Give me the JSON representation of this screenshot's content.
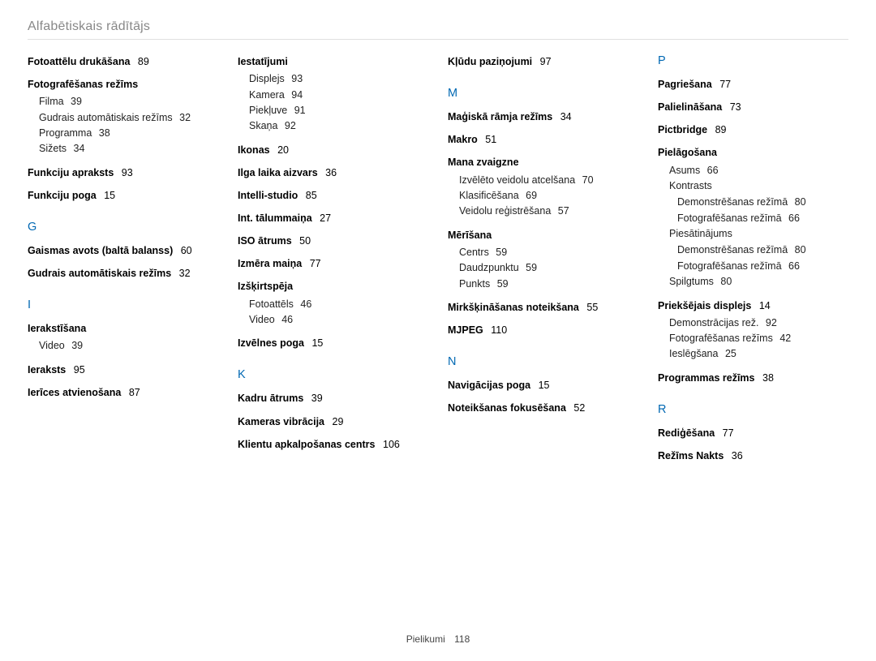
{
  "header": "Alfabētiskais rādītājs",
  "footer": {
    "section": "Pielikumi",
    "page": "118"
  },
  "columns": [
    {
      "items": [
        {
          "type": "entry",
          "title": "Fotoattēlu drukāšana",
          "page": "89"
        },
        {
          "type": "entry",
          "title": "Fotografēšanas režīms",
          "subs": [
            {
              "label": "Filma",
              "page": "39"
            },
            {
              "label": "Gudrais automātiskais režīms",
              "page": "32"
            },
            {
              "label": "Programma",
              "page": "38"
            },
            {
              "label": "Sižets",
              "page": "34"
            }
          ]
        },
        {
          "type": "entry",
          "title": "Funkciju apraksts",
          "page": "93"
        },
        {
          "type": "entry",
          "title": "Funkciju poga",
          "page": "15"
        },
        {
          "type": "letter",
          "text": "G"
        },
        {
          "type": "entry",
          "title": "Gaismas avots (baltā balanss)",
          "page": "60"
        },
        {
          "type": "entry",
          "title": "Gudrais automātiskais režīms",
          "page": "32"
        },
        {
          "type": "letter",
          "text": "I"
        },
        {
          "type": "entry",
          "title": "Ierakstīšana",
          "subs": [
            {
              "label": "Video",
              "page": "39"
            }
          ]
        },
        {
          "type": "entry",
          "title": "Ieraksts",
          "page": "95"
        },
        {
          "type": "entry",
          "title": "Ierīces atvienošana",
          "page": "87"
        }
      ]
    },
    {
      "items": [
        {
          "type": "entry",
          "title": "Iestatījumi",
          "subs": [
            {
              "label": "Displejs",
              "page": "93"
            },
            {
              "label": "Kamera",
              "page": "94"
            },
            {
              "label": "Piekļuve",
              "page": "91"
            },
            {
              "label": "Skaņa",
              "page": "92"
            }
          ]
        },
        {
          "type": "entry",
          "title": "Ikonas",
          "page": "20"
        },
        {
          "type": "entry",
          "title": "Ilga laika aizvars",
          "page": "36"
        },
        {
          "type": "entry",
          "title": "Intelli-studio",
          "page": "85"
        },
        {
          "type": "entry",
          "title": "Int. tālummaiņa",
          "page": "27"
        },
        {
          "type": "entry",
          "title": "ISO ātrums",
          "page": "50"
        },
        {
          "type": "entry",
          "title": "Izmēra maiņa",
          "page": "77"
        },
        {
          "type": "entry",
          "title": "Izšķirtspēja",
          "subs": [
            {
              "label": "Fotoattēls",
              "page": "46"
            },
            {
              "label": "Video",
              "page": "46"
            }
          ]
        },
        {
          "type": "entry",
          "title": "Izvēlnes poga",
          "page": "15"
        },
        {
          "type": "letter",
          "text": "K"
        },
        {
          "type": "entry",
          "title": "Kadru ātrums",
          "page": "39"
        },
        {
          "type": "entry",
          "title": "Kameras vibrācija",
          "page": "29"
        },
        {
          "type": "entry",
          "title": "Klientu apkalpošanas centrs",
          "page": "106"
        }
      ]
    },
    {
      "items": [
        {
          "type": "entry",
          "title": "Kļūdu paziņojumi",
          "page": "97"
        },
        {
          "type": "letter",
          "text": "M"
        },
        {
          "type": "entry",
          "title": "Maģiskā rāmja režīms",
          "page": "34"
        },
        {
          "type": "entry",
          "title": "Makro",
          "page": "51"
        },
        {
          "type": "entry",
          "title": "Mana zvaigzne",
          "subs": [
            {
              "label": "Izvēlēto veidolu atcelšana",
              "page": "70"
            },
            {
              "label": "Klasificēšana",
              "page": "69"
            },
            {
              "label": "Veidolu reģistrēšana",
              "page": "57"
            }
          ]
        },
        {
          "type": "entry",
          "title": "Mērīšana",
          "subs": [
            {
              "label": "Centrs",
              "page": "59"
            },
            {
              "label": "Daudzpunktu",
              "page": "59"
            },
            {
              "label": "Punkts",
              "page": "59"
            }
          ]
        },
        {
          "type": "entry",
          "title": "Mirkšķināšanas noteikšana",
          "page": "55"
        },
        {
          "type": "entry",
          "title": "MJPEG",
          "page": "110"
        },
        {
          "type": "letter",
          "text": "N"
        },
        {
          "type": "entry",
          "title": "Navigācijas poga",
          "page": "15"
        },
        {
          "type": "entry",
          "title": "Noteikšanas fokusēšana",
          "page": "52"
        }
      ]
    },
    {
      "items": [
        {
          "type": "letter",
          "text": "P",
          "first": true
        },
        {
          "type": "entry",
          "title": "Pagriešana",
          "page": "77"
        },
        {
          "type": "entry",
          "title": "Palielināšana",
          "page": "73"
        },
        {
          "type": "entry",
          "title": "Pictbridge",
          "page": "89"
        },
        {
          "type": "entry",
          "title": "Pielāgošana",
          "subs": [
            {
              "label": "Asums",
              "page": "66"
            },
            {
              "label": "Kontrasts",
              "subsubs": [
                {
                  "label": "Demonstrēšanas režīmā",
                  "page": "80"
                },
                {
                  "label": "Fotografēšanas režīmā",
                  "page": "66"
                }
              ]
            },
            {
              "label": "Piesātinājums",
              "subsubs": [
                {
                  "label": "Demonstrēšanas režīmā",
                  "page": "80"
                },
                {
                  "label": "Fotografēšanas režīmā",
                  "page": "66"
                }
              ]
            },
            {
              "label": "Spilgtums",
              "page": "80"
            }
          ]
        },
        {
          "type": "entry",
          "title": "Priekšējais displejs",
          "page": "14",
          "subs": [
            {
              "label": "Demonstrācijas rež.",
              "page": "92"
            },
            {
              "label": "Fotografēšanas režīms",
              "page": "42"
            },
            {
              "label": "Ieslēgšana",
              "page": "25"
            }
          ]
        },
        {
          "type": "entry",
          "title": "Programmas režīms",
          "page": "38"
        },
        {
          "type": "letter",
          "text": "R"
        },
        {
          "type": "entry",
          "title": "Rediģēšana",
          "page": "77"
        },
        {
          "type": "entry",
          "title": "Režīms Nakts",
          "page": "36"
        }
      ]
    }
  ]
}
